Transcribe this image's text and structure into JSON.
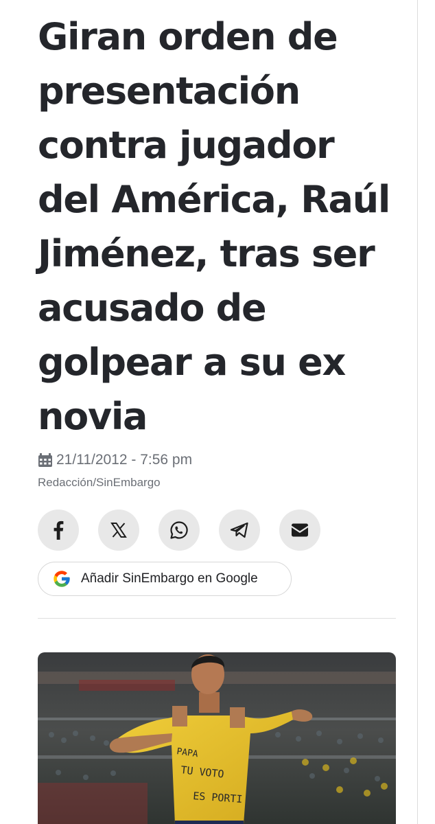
{
  "article": {
    "headline": "Giran orden de presentación contra jugador del América, Raúl Jiménez, tras ser acusado de golpear a su ex novia",
    "date": "21/11/2012 - 7:56 pm",
    "byline": "Redacción/SinEmbargo"
  },
  "share": {
    "icons": [
      "facebook-icon",
      "x-icon",
      "whatsapp-icon",
      "telegram-icon",
      "email-icon"
    ]
  },
  "google_cta": {
    "label": "Añadir SinEmbargo en Google",
    "icon": "google-icon"
  },
  "hero_image": {
    "shirt_text": [
      "PAPA",
      "TU VOTO",
      "ES PORTI"
    ]
  },
  "colors": {
    "text": "#24262b",
    "meta": "#6b6f76",
    "button_bg": "#e8e8e8",
    "shirt": "#e7c12c"
  }
}
